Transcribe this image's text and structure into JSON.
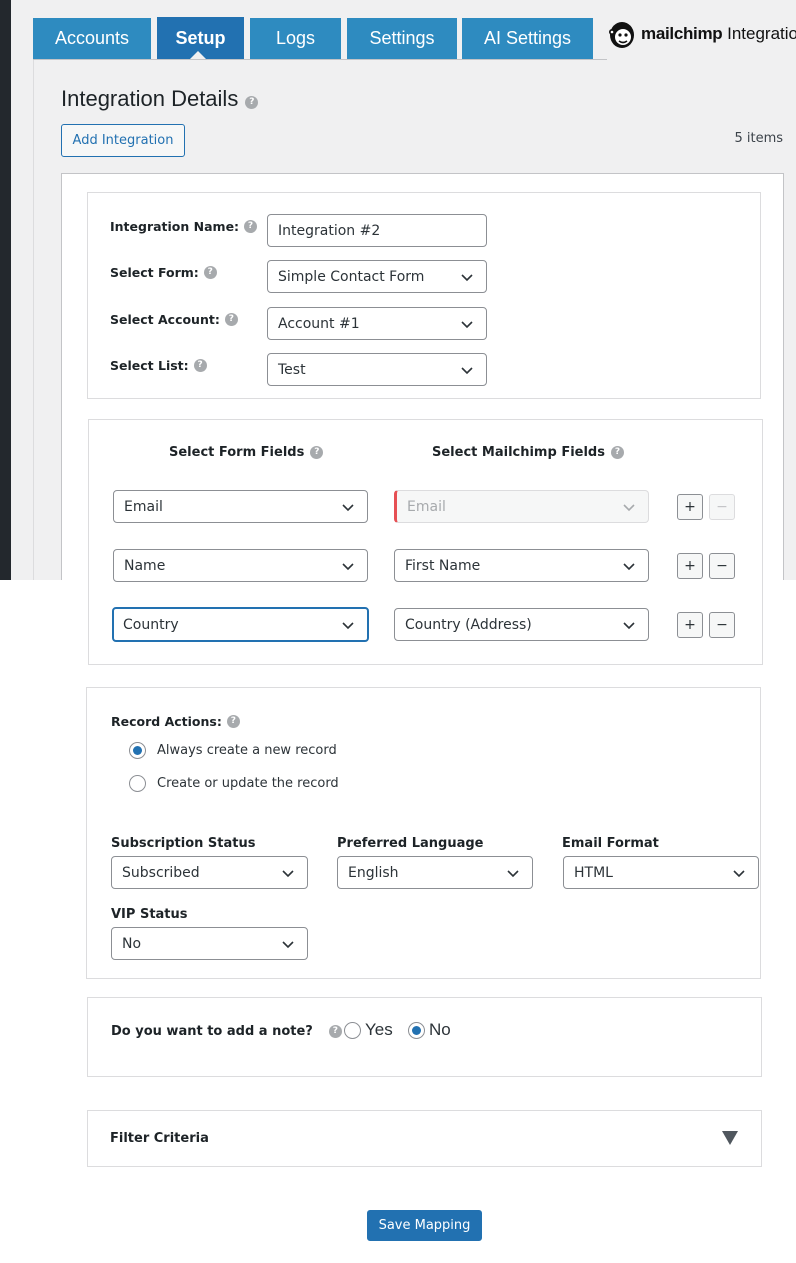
{
  "tabs": [
    {
      "label": "Accounts"
    },
    {
      "label": "Setup",
      "active": true
    },
    {
      "label": "Logs"
    },
    {
      "label": "Settings"
    },
    {
      "label": "AI Settings"
    }
  ],
  "brand": {
    "name_bold": "mailchimp",
    "name_rest": " Integratio",
    "icon": "mailchimp-freddie-icon"
  },
  "header": {
    "title": "Integration Details",
    "add_button": "Add Integration",
    "items_count": "5 items"
  },
  "integration": {
    "name_label": "Integration Name:",
    "name_value": "Integration #2",
    "form_label": "Select Form:",
    "form_value": "Simple Contact Form",
    "account_label": "Select Account:",
    "account_value": "Account #1",
    "list_label": "Select List:",
    "list_value": "Test"
  },
  "mapping": {
    "form_fields_head": "Select Form Fields",
    "mc_fields_head": "Select Mailchimp Fields",
    "rows": [
      {
        "form_field": "Email",
        "mc_field": "Email",
        "plus": "+",
        "minus": "−"
      },
      {
        "form_field": "Name",
        "mc_field": "First Name",
        "plus": "+",
        "minus": "−"
      },
      {
        "form_field": "Country",
        "mc_field": "Country (Address)",
        "plus": "+",
        "minus": "−"
      }
    ]
  },
  "record_actions": {
    "label": "Record Actions:",
    "options": [
      {
        "label": "Always create a new record",
        "checked": true
      },
      {
        "label": "Create or update the record",
        "checked": false
      }
    ]
  },
  "subscription": {
    "status_label": "Subscription Status",
    "status_value": "Subscribed",
    "language_label": "Preferred Language",
    "language_value": "English",
    "format_label": "Email Format",
    "format_value": "HTML",
    "vip_label": "VIP Status",
    "vip_value": "No"
  },
  "note": {
    "question": "Do you want to add a note?",
    "yes": "Yes",
    "no": "No",
    "selected": "No"
  },
  "filter": {
    "title": "Filter Criteria"
  },
  "footer": {
    "save_button": "Save Mapping"
  },
  "colors": {
    "accent": "#2271b1",
    "tab": "#2e8bc0",
    "error": "#e65054"
  }
}
